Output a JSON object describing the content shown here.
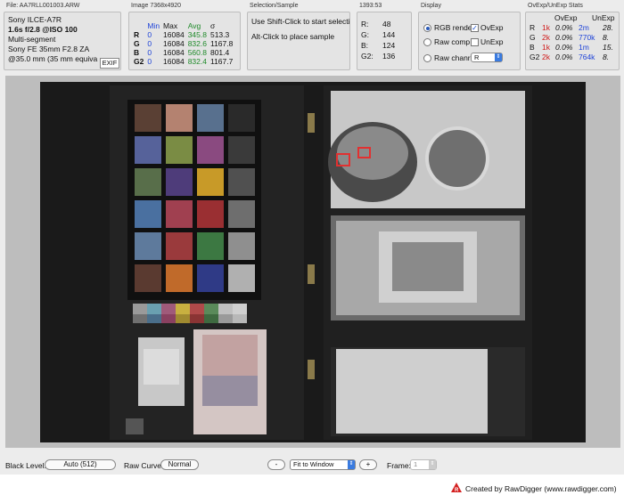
{
  "file_panel": {
    "title": "File: AA7RLL001003.ARW",
    "camera": "Sony ILCE-A7R",
    "exposure": "1.6s f/2.8 @ISO 100",
    "metering": "Multi-segment",
    "lens": "Sony FE 35mm F2.8 ZA",
    "focal": "@35.0 mm (35 mm equiva",
    "exif_button": "EXIF"
  },
  "image_panel": {
    "title": "Image 7368x4920",
    "headers": [
      "",
      "Min",
      "Max",
      "Avg",
      "σ"
    ],
    "rows": [
      {
        "ch": "R",
        "min": "0",
        "max": "16084",
        "avg": "345.8",
        "sigma": "513.3"
      },
      {
        "ch": "G",
        "min": "0",
        "max": "16084",
        "avg": "832.6",
        "sigma": "1167.8"
      },
      {
        "ch": "B",
        "min": "0",
        "max": "16084",
        "avg": "560.8",
        "sigma": "801.4"
      },
      {
        "ch": "G2",
        "min": "0",
        "max": "16084",
        "avg": "832.4",
        "sigma": "1167.7"
      }
    ]
  },
  "selection_panel": {
    "title": "Selection/Sample",
    "line1": "Use Shift-Click to start selecti",
    "line2": "Alt-Click to place sample"
  },
  "pixel_panel": {
    "title": "1393:53",
    "rows": [
      {
        "label": "R:",
        "value": "48"
      },
      {
        "label": "G:",
        "value": "144"
      },
      {
        "label": "B:",
        "value": "124"
      },
      {
        "label": "G2:",
        "value": "136"
      }
    ]
  },
  "display_panel": {
    "title": "Display",
    "rgb_render": "RGB rende",
    "raw_composite": "Raw comp",
    "raw_channel": "Raw chanr",
    "ovexp": "OvExp",
    "unexp": "UnExp",
    "channel_select": "R"
  },
  "stats_panel": {
    "title": "OvExp/UnExp Stats",
    "head_ov": "OvExp",
    "head_un": "UnExp",
    "rows": [
      {
        "ch": "R",
        "ov_n": "1k",
        "ov_p": "0.0%",
        "un_n": "2m",
        "un_p": "28."
      },
      {
        "ch": "G",
        "ov_n": "2k",
        "ov_p": "0.0%",
        "un_n": "770k",
        "un_p": "8."
      },
      {
        "ch": "B",
        "ov_n": "1k",
        "ov_p": "0.0%",
        "un_n": "1m",
        "un_p": "15."
      },
      {
        "ch": "G2",
        "ov_n": "2k",
        "ov_p": "0.0%",
        "un_n": "764k",
        "un_p": "8."
      }
    ]
  },
  "toolbar": {
    "black_level_label": "Black Level:",
    "black_level_value": "Auto (512)",
    "raw_curve_label": "Raw Curve:",
    "raw_curve_value": "Normal",
    "zoom_out": "-",
    "zoom_mode": "Fit to Window",
    "zoom_in": "+",
    "frame_label": "Frame:",
    "frame_value": "1"
  },
  "footer": {
    "credit": "Created by RawDigger (www.rawdigger.com)"
  },
  "colors": {
    "accent": "#3a7be0",
    "overexposure": "#d01919",
    "min_blue": "#1f44d8",
    "avg_green": "#1f8a2a"
  }
}
